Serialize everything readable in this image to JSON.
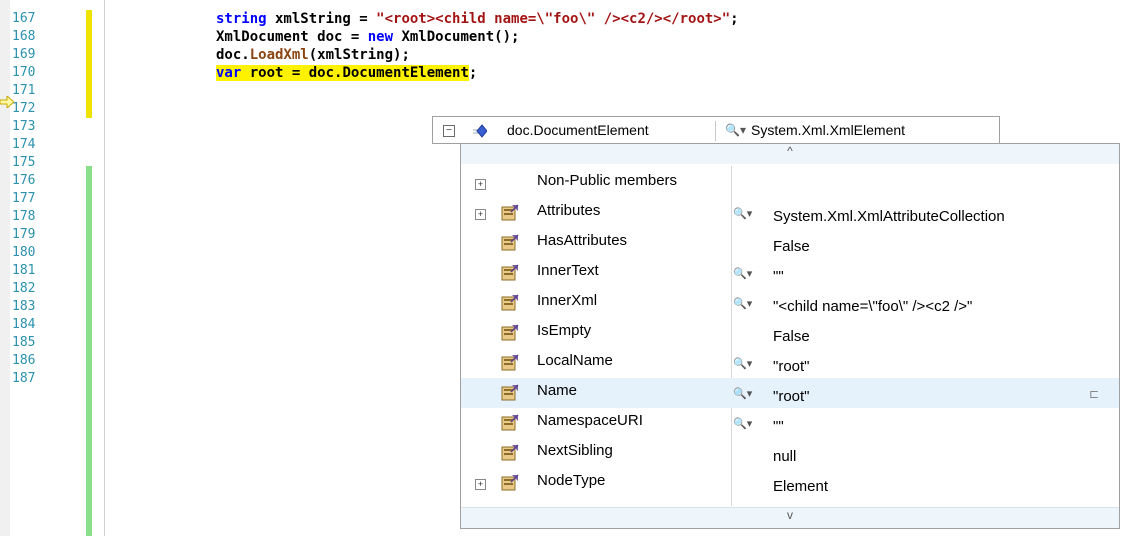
{
  "editor": {
    "line_numbers": [
      "167",
      "168",
      "169",
      "170",
      "171",
      "172",
      "173",
      "174",
      "175",
      "176",
      "177",
      "178",
      "179",
      "180",
      "181",
      "182",
      "183",
      "184",
      "185",
      "186",
      "187"
    ],
    "current_line": "170"
  },
  "code": {
    "line1_a": "string",
    "line1_b": " xmlString = ",
    "line1_c": "\"<root><child name=\\\"foo\\\" /><c2/></root>\"",
    "line1_d": ";",
    "line2_a": "XmlDocument doc = ",
    "line2_b": "new",
    "line2_c": " XmlDocument",
    "line2_d": "();",
    "line3_a": "doc.",
    "line3_b": "LoadXml",
    "line3_c": "(xmlString);",
    "line4_a": "var",
    "line4_b": " root = doc.DocumentElement",
    "line4_c": ";"
  },
  "datatip": {
    "expander": "−",
    "expression": "doc.DocumentElement",
    "magnifier": "🔍▾",
    "type": "System.Xml.XmlElement",
    "scroll_up": "^",
    "scroll_down": "v",
    "rows": [
      {
        "expandable": "+",
        "name": "Non-Public members",
        "magnifier": "",
        "value": ""
      },
      {
        "expandable": "+",
        "name": "Attributes",
        "magnifier": "🔍▾",
        "value": "System.Xml.XmlAttributeCollection"
      },
      {
        "expandable": "",
        "name": "HasAttributes",
        "magnifier": "",
        "value": "False"
      },
      {
        "expandable": "",
        "name": "InnerText",
        "magnifier": "🔍▾",
        "value": "\"\""
      },
      {
        "expandable": "",
        "name": "InnerXml",
        "magnifier": "🔍▾",
        "value": "\"<child name=\\\"foo\\\" /><c2 />\""
      },
      {
        "expandable": "",
        "name": "IsEmpty",
        "magnifier": "",
        "value": "False"
      },
      {
        "expandable": "",
        "name": "LocalName",
        "magnifier": "🔍▾",
        "value": "\"root\""
      },
      {
        "expandable": "",
        "name": "Name",
        "magnifier": "🔍▾",
        "value": "\"root\""
      },
      {
        "expandable": "",
        "name": "NamespaceURI",
        "magnifier": "🔍▾",
        "value": "\"\""
      },
      {
        "expandable": "",
        "name": "NextSibling",
        "magnifier": "",
        "value": "null"
      },
      {
        "expandable": "+",
        "name": "NodeType",
        "magnifier": "",
        "value": "Element"
      }
    ]
  }
}
